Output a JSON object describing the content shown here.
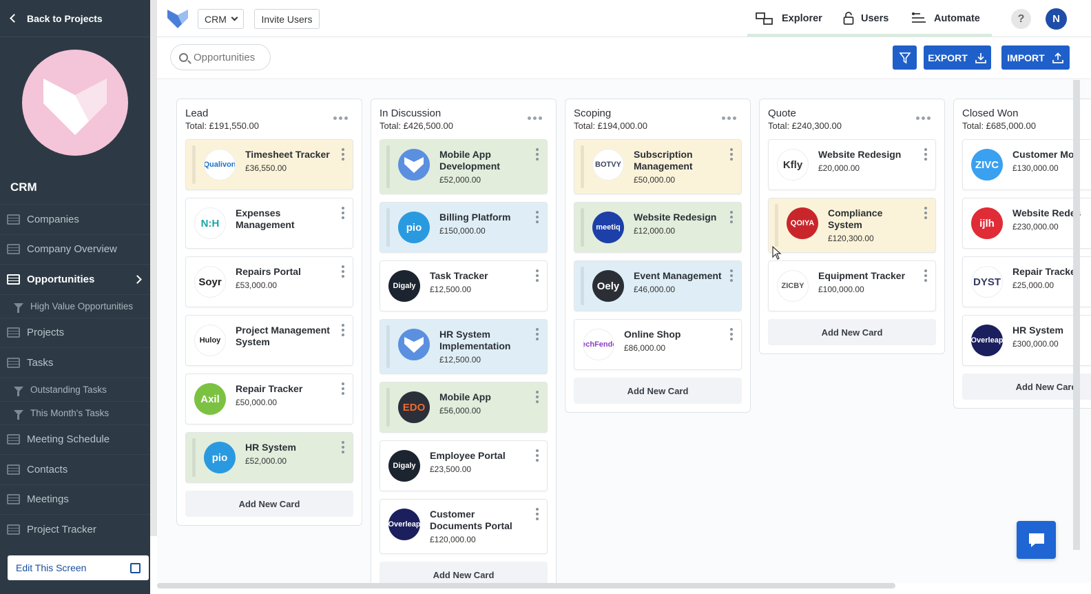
{
  "sidebar": {
    "back_label": "Back to Projects",
    "app_name": "CRM",
    "items": [
      {
        "label": "Companies",
        "type": "item"
      },
      {
        "label": "Company Overview",
        "type": "item"
      },
      {
        "label": "Opportunities",
        "type": "item",
        "active": true
      },
      {
        "label": "High Value Opportunities",
        "type": "filter"
      },
      {
        "label": "Projects",
        "type": "item"
      },
      {
        "label": "Tasks",
        "type": "item"
      },
      {
        "label": "Outstanding Tasks",
        "type": "filter"
      },
      {
        "label": "This Month's Tasks",
        "type": "filter"
      },
      {
        "label": "Meeting Schedule",
        "type": "item"
      },
      {
        "label": "Contacts",
        "type": "item"
      },
      {
        "label": "Meetings",
        "type": "item"
      },
      {
        "label": "Project Tracker",
        "type": "item"
      }
    ],
    "edit_label": "Edit This Screen"
  },
  "topbar": {
    "app_select": "CRM",
    "invite_label": "Invite Users",
    "nav": {
      "explorer": "Explorer",
      "users": "Users",
      "automate": "Automate"
    },
    "help": "?",
    "avatar_initial": "N"
  },
  "toolbar": {
    "search_placeholder": "Opportunities",
    "export_label": "EXPORT",
    "import_label": "IMPORT"
  },
  "board": {
    "add_card_label": "Add New Card",
    "columns": [
      {
        "title": "Lead",
        "total": "Total: £191,550.00",
        "cards": [
          {
            "name": "Timesheet Tracker",
            "amount": "£36,550.00",
            "color": "yellow",
            "logo": "Qualivon",
            "logo_bg": "#ffffff",
            "logo_fg": "#1a73c9"
          },
          {
            "name": "Expenses Management",
            "amount": "",
            "color": "white",
            "logo": "N:H",
            "logo_bg": "#ffffff",
            "logo_fg": "#1aa6a6"
          },
          {
            "name": "Repairs Portal",
            "amount": "£53,000.00",
            "color": "white",
            "logo": "Soyr",
            "logo_bg": "#ffffff",
            "logo_fg": "#222222"
          },
          {
            "name": "Project Management System",
            "amount": "",
            "color": "white",
            "logo": "Huloy",
            "logo_bg": "#ffffff",
            "logo_fg": "#222222"
          },
          {
            "name": "Repair Tracker",
            "amount": "£50,000.00",
            "color": "white",
            "logo": "Axil",
            "logo_bg": "#7cc242",
            "logo_fg": "#ffffff"
          },
          {
            "name": "HR System",
            "amount": "£52,000.00",
            "color": "green",
            "logo": "pio",
            "logo_bg": "#2a9ae0",
            "logo_fg": "#ffffff"
          }
        ]
      },
      {
        "title": "In Discussion",
        "total": "Total: £426,500.00",
        "cards": [
          {
            "name": "Mobile App Development",
            "amount": "£52,000.00",
            "color": "green",
            "logo": "shield",
            "logo_bg": "#5b8fe0",
            "logo_fg": "#ffffff"
          },
          {
            "name": "Billing Platform",
            "amount": "£150,000.00",
            "color": "blue",
            "logo": "pio",
            "logo_bg": "#2a9ae0",
            "logo_fg": "#ffffff"
          },
          {
            "name": "Task Tracker",
            "amount": "£12,500.00",
            "color": "white",
            "logo": "Digaly",
            "logo_bg": "#1c2430",
            "logo_fg": "#ffffff"
          },
          {
            "name": "HR System Implementation",
            "amount": "£12,500.00",
            "color": "blue",
            "logo": "shield",
            "logo_bg": "#5b8fe0",
            "logo_fg": "#ffffff"
          },
          {
            "name": "Mobile App",
            "amount": "£56,000.00",
            "color": "green",
            "logo": "EDO",
            "logo_bg": "#2b2f3a",
            "logo_fg": "#f06a2a"
          },
          {
            "name": "Employee Portal",
            "amount": "£23,500.00",
            "color": "white",
            "logo": "Digaly",
            "logo_bg": "#1c2430",
            "logo_fg": "#ffffff"
          },
          {
            "name": "Customer Documents Portal",
            "amount": "£120,000.00",
            "color": "white",
            "logo": "Overleap",
            "logo_bg": "#1b1f5e",
            "logo_fg": "#ffffff"
          }
        ]
      },
      {
        "title": "Scoping",
        "total": "Total: £194,000.00",
        "cards": [
          {
            "name": "Subscription Management",
            "amount": "£50,000.00",
            "color": "yellow",
            "logo": "BOTVY",
            "logo_bg": "#ffffff",
            "logo_fg": "#3a4560"
          },
          {
            "name": "Website Redesign",
            "amount": "£12,000.00",
            "color": "green",
            "logo": "meetiq",
            "logo_bg": "#1c3fa8",
            "logo_fg": "#ffffff"
          },
          {
            "name": "Event Management",
            "amount": "£46,000.00",
            "color": "blue",
            "logo": "Oely",
            "logo_bg": "#2b2f35",
            "logo_fg": "#ffffff"
          },
          {
            "name": "Online Shop",
            "amount": "£86,000.00",
            "color": "white",
            "logo": "TechFender",
            "logo_bg": "#ffffff",
            "logo_fg": "#8a3ec8"
          }
        ]
      },
      {
        "title": "Quote",
        "total": "Total: £240,300.00",
        "cards": [
          {
            "name": "Website Redesign",
            "amount": "£20,000.00",
            "color": "white",
            "logo": "Kfly",
            "logo_bg": "#ffffff",
            "logo_fg": "#333333"
          },
          {
            "name": "Compliance System",
            "amount": "£120,300.00",
            "color": "yellow",
            "logo": "QOIYA",
            "logo_bg": "#c9262b",
            "logo_fg": "#ffffff"
          },
          {
            "name": "Equipment Tracker",
            "amount": "£100,000.00",
            "color": "white",
            "logo": "ZICBY",
            "logo_bg": "#ffffff",
            "logo_fg": "#555555"
          }
        ]
      },
      {
        "title": "Closed Won",
        "total": "Total: £685,000.00",
        "cards": [
          {
            "name": "Customer Mob",
            "amount": "£130,000.00",
            "color": "white",
            "logo": "ZIVC",
            "logo_bg": "#3aa0f0",
            "logo_fg": "#ffffff"
          },
          {
            "name": "Website Redes",
            "amount": "£230,000.00",
            "color": "white",
            "logo": "ijlh",
            "logo_bg": "#e02c36",
            "logo_fg": "#ffffff"
          },
          {
            "name": "Repair Tracke",
            "amount": "£25,000.00",
            "color": "white",
            "logo": "DYST",
            "logo_bg": "#ffffff",
            "logo_fg": "#333a66"
          },
          {
            "name": "HR System",
            "amount": "£300,000.00",
            "color": "white",
            "logo": "Overleap",
            "logo_bg": "#1b1f5e",
            "logo_fg": "#ffffff"
          }
        ]
      }
    ]
  }
}
